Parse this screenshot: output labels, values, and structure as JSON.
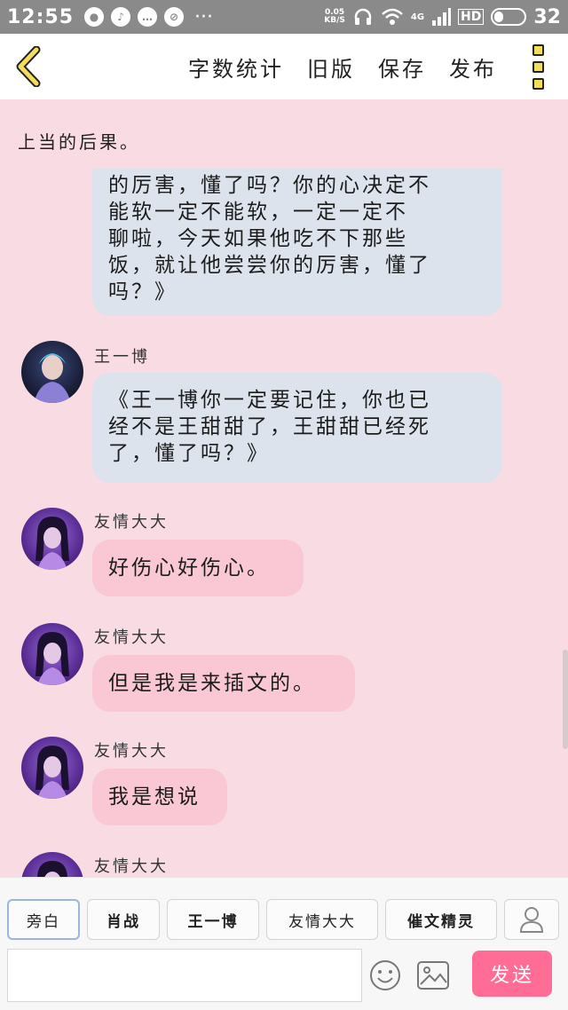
{
  "status_bar": {
    "time": "12:55",
    "speed_top": "0.05",
    "speed_bottom": "KB/S",
    "network": "4G",
    "hd": "HD",
    "battery": "32"
  },
  "toolbar": {
    "word_count": "字数统计",
    "old_version": "旧版",
    "save": "保存",
    "publish": "发布"
  },
  "chat": {
    "narration": "上当的后果。",
    "messages": [
      {
        "lines": [
          "的厉害，懂了吗？你的心决定不",
          "能软一定不能软，一定一定不",
          "聊啦，今天如果他吃不下那些",
          "饭，就让他尝尝你的厉害，懂了",
          "吗？》"
        ]
      },
      {
        "sender": "王一博",
        "lines": [
          "《王一博你一定要记住，你也已",
          "经不是王甜甜了，王甜甜已经死",
          "了，懂了吗？》"
        ]
      },
      {
        "sender": "友情大大",
        "text": "好伤心好伤心。"
      },
      {
        "sender": "友情大大",
        "text": "但是我是来插文的。"
      },
      {
        "sender": "友情大大",
        "text": "我是想说"
      },
      {
        "sender": "友情大大"
      }
    ]
  },
  "bottom": {
    "roles": [
      "旁白",
      "肖战",
      "王一博",
      "友情大大",
      "催文精灵"
    ],
    "send": "发送"
  },
  "colors": {
    "background": "#f9dbe4",
    "blue_bubble": "#dde3ec",
    "pink_bubble": "#f9c8d4",
    "send_button": "#ff6c96"
  }
}
